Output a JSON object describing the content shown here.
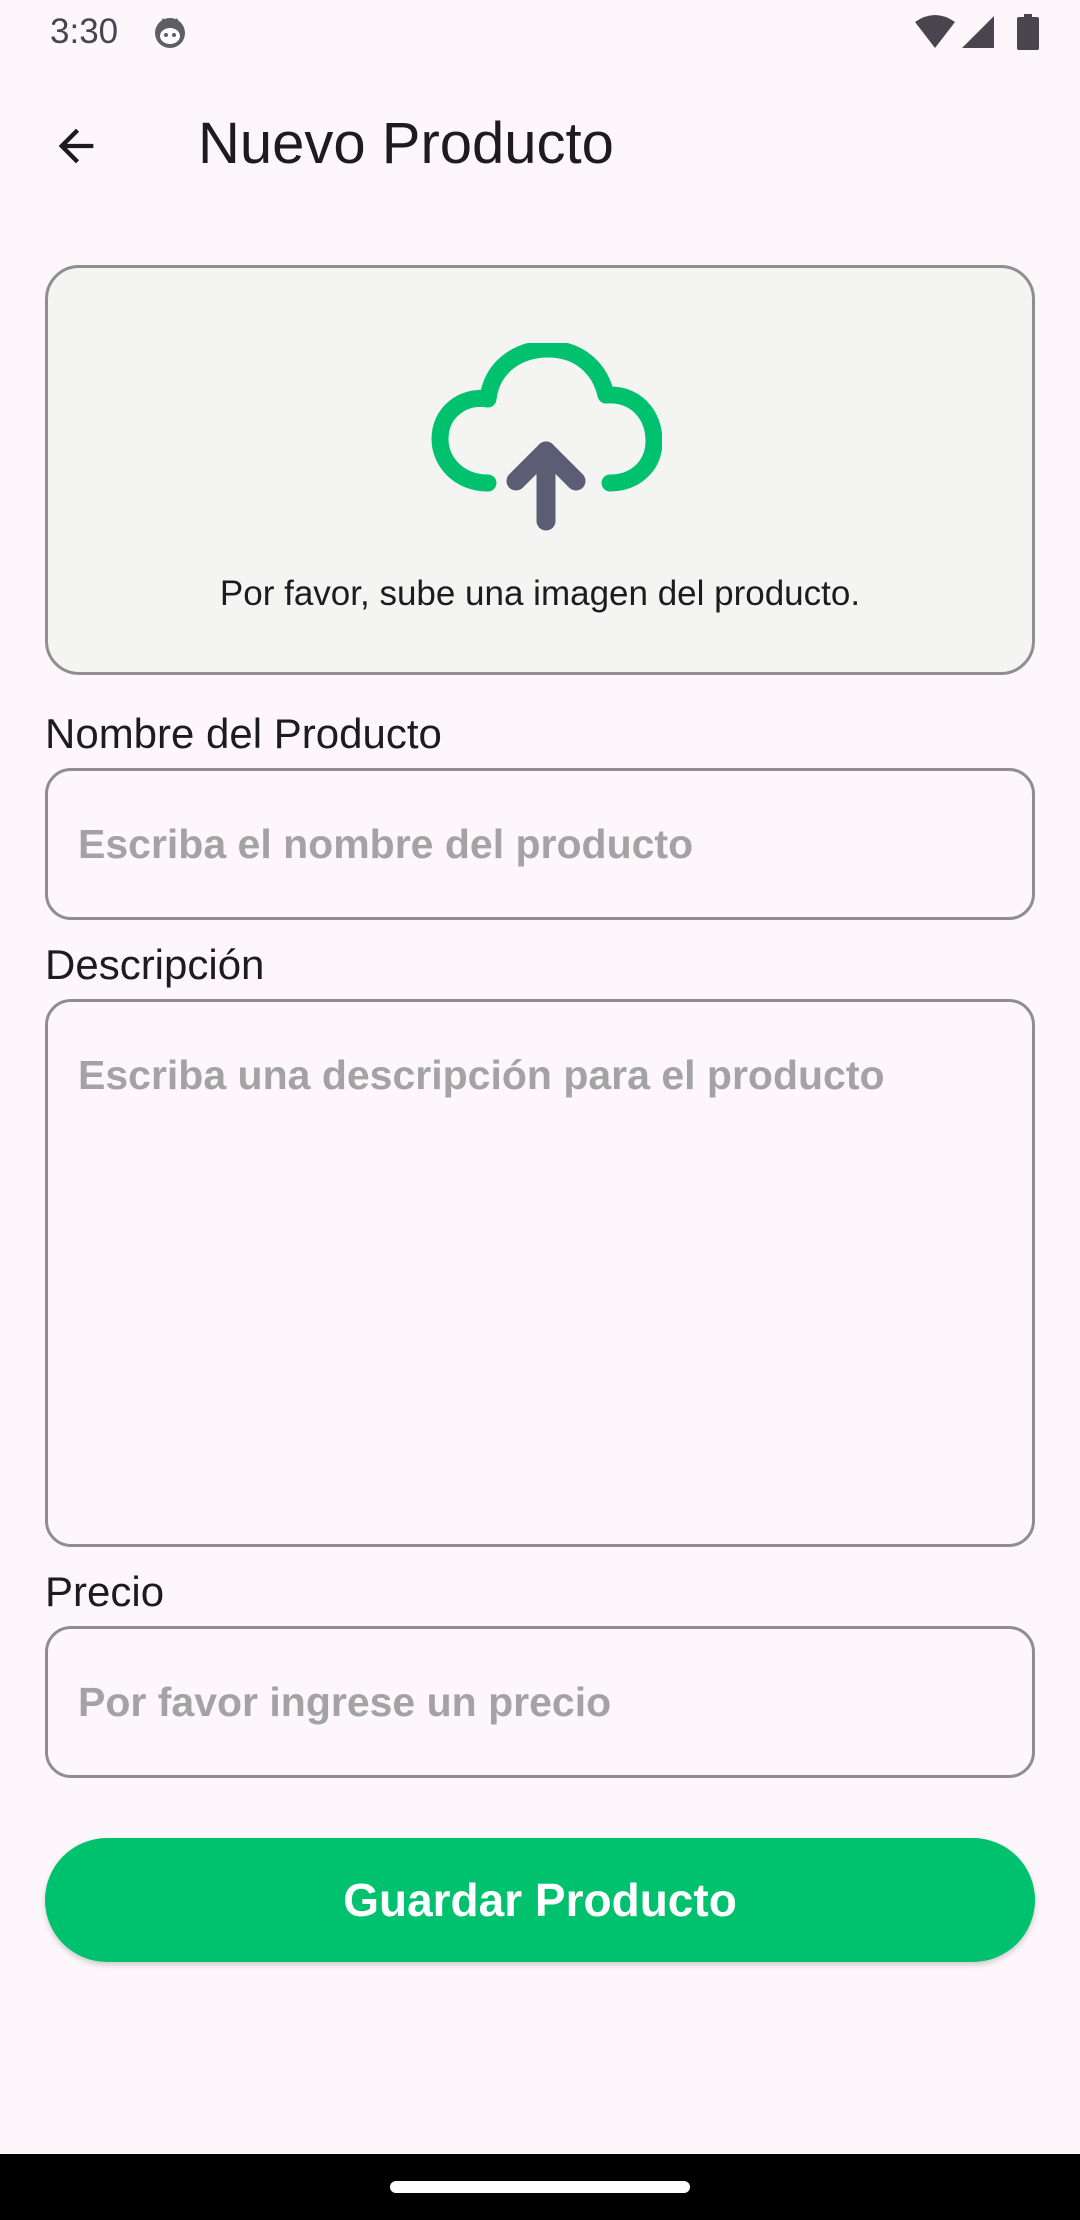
{
  "status_bar": {
    "time": "3:30",
    "app_icon": "android-cat-icon",
    "icons": [
      "wifi-icon",
      "signal-icon",
      "battery-icon"
    ]
  },
  "app_bar": {
    "back_icon": "arrow-back-icon",
    "title": "Nuevo Producto"
  },
  "upload": {
    "icon": "cloud-upload-icon",
    "text": "Por favor, sube una imagen del producto.",
    "colors": {
      "cloud": "#00c26e",
      "arrow": "#5a5d74"
    }
  },
  "form": {
    "name": {
      "label": "Nombre del Producto",
      "value": "",
      "placeholder": "Escriba el nombre del producto"
    },
    "description": {
      "label": "Descripción",
      "value": "",
      "placeholder": "Escriba una descripción para el producto"
    },
    "price": {
      "label": "Precio",
      "value": "",
      "placeholder": "Por favor ingrese un precio"
    }
  },
  "save_button": {
    "label": "Guardar Producto",
    "color": "#00c26e"
  }
}
